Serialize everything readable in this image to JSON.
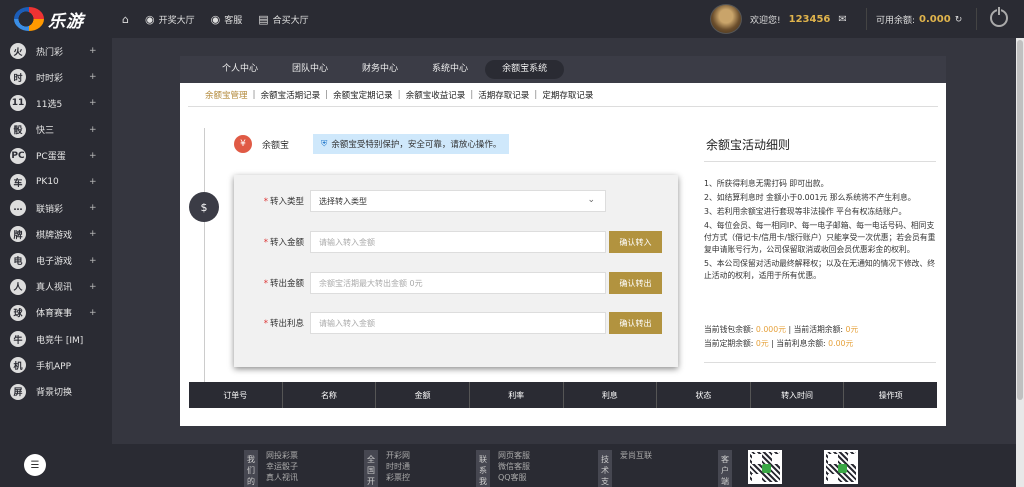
{
  "brand": {
    "name": "乐游"
  },
  "topnav": [
    {
      "icon": "home-icon",
      "label": ""
    },
    {
      "icon": "lottery-hall-icon",
      "label": "开奖大厅"
    },
    {
      "icon": "service-icon",
      "label": "客服"
    },
    {
      "icon": "buy-hall-icon",
      "label": "合买大厅"
    }
  ],
  "user": {
    "welcome": "欢迎您!",
    "name": "123456",
    "balance_label": "可用余额:",
    "balance": "0.000"
  },
  "sidebar": {
    "items": [
      {
        "label": "热门彩",
        "glyph": "火",
        "plus": "+"
      },
      {
        "label": "时时彩",
        "glyph": "时",
        "plus": "+"
      },
      {
        "label": "11选5",
        "glyph": "11",
        "plus": "+"
      },
      {
        "label": "快三",
        "glyph": "骰",
        "plus": "+"
      },
      {
        "label": "PC蛋蛋",
        "glyph": "PC",
        "plus": "+"
      },
      {
        "label": "PK10",
        "glyph": "车",
        "plus": "+"
      },
      {
        "label": "联销彩",
        "glyph": "…",
        "plus": "+"
      },
      {
        "label": "棋牌游戏",
        "glyph": "牌",
        "plus": "+"
      },
      {
        "label": "电子游戏",
        "glyph": "电",
        "plus": "+"
      },
      {
        "label": "真人视讯",
        "glyph": "人",
        "plus": "+"
      },
      {
        "label": "体育赛事",
        "glyph": "球",
        "plus": "+"
      },
      {
        "label": "电竞牛 [IM]",
        "glyph": "牛",
        "plus": ""
      },
      {
        "label": "手机APP",
        "glyph": "机",
        "plus": ""
      },
      {
        "label": "背景切换",
        "glyph": "屏",
        "plus": ""
      }
    ]
  },
  "tabs": [
    "个人中心",
    "团队中心",
    "财务中心",
    "系统中心",
    "余额宝系统"
  ],
  "subtabs": [
    "余额宝管理",
    "余额宝活期记录",
    "余额宝定期记录",
    "余额宝收益记录",
    "活期存取记录",
    "定期存取记录"
  ],
  "yeb": {
    "name": "余额宝",
    "notice": "余额宝受特别保护，安全可靠，请放心操作。"
  },
  "form": {
    "rows": [
      {
        "label": "转入类型",
        "placeholder": "选择转入类型",
        "button": ""
      },
      {
        "label": "转入金额",
        "placeholder": "请输入转入金额",
        "button": "确认转入"
      },
      {
        "label": "转出金额",
        "placeholder": "余额宝活期最大转出金额 0元",
        "button": "确认转出"
      },
      {
        "label": "转出利息",
        "placeholder": "请输入转入金额",
        "button": "确认转出"
      }
    ]
  },
  "detail": {
    "title": "余额宝活动细则",
    "rules": [
      "1、所获得利息无需打码 即可出款。",
      "2、如结算利息时 金额小于0.001元 那么系统将不产生利息。",
      "3、若利用余额宝进行套现等非法操作 平台有权冻结账户。",
      "4、每位会员、每一相同IP、每一电子邮箱、每一电话号码、相同支付方式（借记卡/信用卡/银行账户）只能享受一次优惠；若会员有重复申请账号行为，公司保留取消或收回会员优惠彩金的权利。",
      "5、本公司保留对活动最终解释权；以及在无通知的情况下修改、终止活动的权利，适用于所有优惠。"
    ],
    "stats": {
      "wallet_label": "当前钱包余额:",
      "wallet_value": "0.000元",
      "current_label": "| 当前活期余额:",
      "current_value": "0元",
      "fixed_label": "当前定期余额:",
      "fixed_value": "0元",
      "interest_label": "| 当前利息余额:",
      "interest_value": "0.00元"
    }
  },
  "table": {
    "columns": [
      "订单号",
      "名称",
      "金额",
      "利率",
      "利息",
      "状态",
      "转入时间",
      "操作项"
    ]
  },
  "footer": {
    "groups": [
      {
        "vlabel": "我们的",
        "links": [
          "网投彩票",
          "幸运骰子",
          "真人视讯"
        ]
      },
      {
        "vlabel": "全国开",
        "links": [
          "开彩网",
          "时时通",
          "彩票控"
        ]
      },
      {
        "vlabel": "联系我",
        "links": [
          "网页客服",
          "微信客服",
          "QQ客服"
        ]
      },
      {
        "vlabel": "技术支",
        "links": [
          "爱尚互联"
        ]
      },
      {
        "vlabel": "客户端",
        "links": []
      }
    ]
  },
  "colors": {
    "dark": "#2a2b33",
    "gold": "#b2933f",
    "accent_text": "#e0b44c",
    "money": "#e6a23c"
  }
}
